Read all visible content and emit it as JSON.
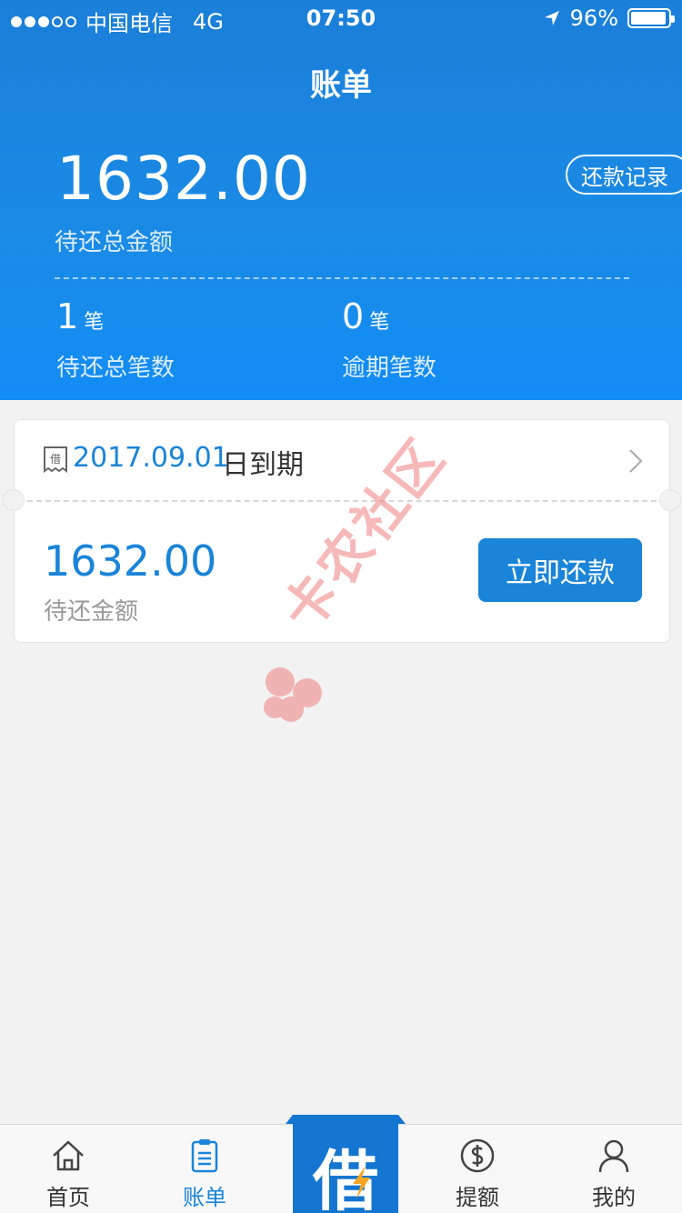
{
  "status_bar": {
    "carrier": "中国电信",
    "network": "4G",
    "time": "07:50",
    "battery": "96%",
    "battery_level": 0.96
  },
  "nav": {
    "title": "账单"
  },
  "summary": {
    "total_amount": "1632.00",
    "total_label": "待还总金额",
    "history_button": "还款记录",
    "pending_count": "1",
    "pending_unit": "笔",
    "pending_label": "待还总笔数",
    "overdue_count": "0",
    "overdue_unit": "笔",
    "overdue_label": "逾期笔数"
  },
  "bill_card": {
    "icon_char": "借",
    "due_date": "2017.09.01",
    "due_suffix": "日到期",
    "amount": "1632.00",
    "amount_label": "待还金额",
    "repay_button": "立即还款"
  },
  "watermark": {
    "text": "卡农社区"
  },
  "tabbar": {
    "home": "首页",
    "bill": "账单",
    "borrow": "借",
    "quota": "提额",
    "mine": "我的"
  },
  "colors": {
    "primary": "#1a84d9",
    "header": "#1a8be6",
    "background": "#f2f2f2"
  }
}
